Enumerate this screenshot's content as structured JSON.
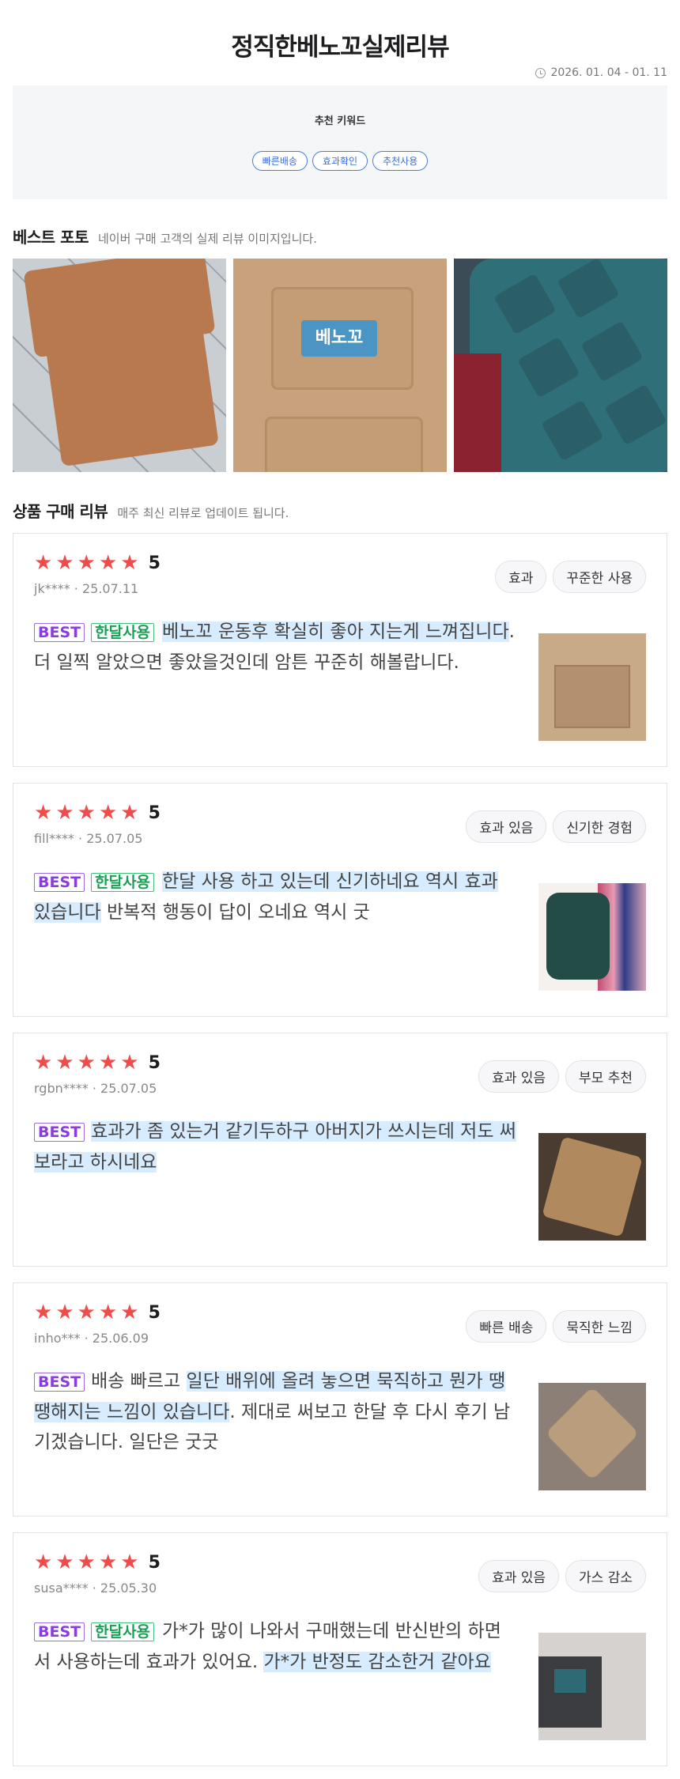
{
  "page_title": "정직한베노꼬실제리뷰",
  "date_range": "2026. 01. 04 - 01. 11",
  "keywords": {
    "title": "추천 키워드",
    "chips": [
      "빠른배송",
      "효과확인",
      "추천사용"
    ]
  },
  "best_photo": {
    "title": "베스트 포토",
    "subtitle": "네이버 구매 고객의 실제 리뷰 이미지입니다.",
    "label_text": "베노꼬"
  },
  "reviews_section": {
    "title": "상품 구매 리뷰",
    "subtitle": "매주 최신 리뷰로 업데이트 됩니다."
  },
  "rating_max": 5,
  "colors": {
    "star": "#ef4c4c",
    "highlight": "#d8ecff",
    "best_badge": "#8a3ce2",
    "month_badge": "#1a9f55",
    "chip": "#3a6cd4"
  },
  "reviews": [
    {
      "score": "5",
      "user": "jk****",
      "date": "25.07.11",
      "tags": [
        "효과",
        "꾸준한 사용"
      ],
      "best": "BEST",
      "month": "한달사용",
      "text_hl": "베노꼬 운동후 확실히 좋아 지는게 느껴집니다",
      "text_rest": ". 더 일찍 알았으면 좋았을것인데 암튼 꾸준히 해볼랍니다."
    },
    {
      "score": "5",
      "user": "fill****",
      "date": "25.07.05",
      "tags": [
        "효과 있음",
        "신기한 경험"
      ],
      "best": "BEST",
      "month": "한달사용",
      "text_hl": "한달 사용 하고 있는데 신기하네요 역시 효과 있습니다",
      "text_rest": " 반복적 행동이 답이 오네요 역시 굿"
    },
    {
      "score": "5",
      "user": "rgbn****",
      "date": "25.07.05",
      "tags": [
        "효과 있음",
        "부모 추천"
      ],
      "best": "BEST",
      "text_hl": "효과가 좀 있는거 같기두하구 아버지가 쓰시는데 저도 써보라고 하시네요",
      "text_rest": ""
    },
    {
      "score": "5",
      "user": "inho***",
      "date": "25.06.09",
      "tags": [
        "빠른 배송",
        "묵직한 느낌"
      ],
      "best": "BEST",
      "text_pre": "배송 빠르고 ",
      "text_hl": "일단 배위에 올려 놓으면 묵직하고 뭔가 땡땡해지는 느낌이 있습니다",
      "text_rest": ". 제대로 써보고 한달 후 다시 후기 남기겠습니다. 일단은 굿굿"
    },
    {
      "score": "5",
      "user": "susa****",
      "date": "25.05.30",
      "tags": [
        "효과 있음",
        "가스 감소"
      ],
      "best": "BEST",
      "month": "한달사용",
      "text_pre": "가*가 많이 나와서 구매했는데 반신반의 하면서 사용하는데 효과가 있어요. ",
      "text_hl": "가*가 반정도 감소한거 같아요",
      "text_rest": ""
    }
  ]
}
